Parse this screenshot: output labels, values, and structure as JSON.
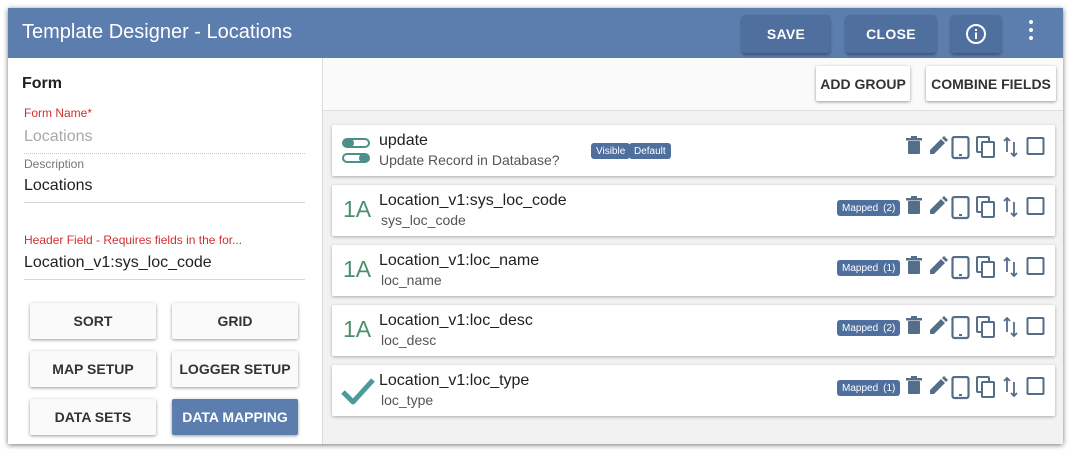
{
  "window": {
    "title": "Template Designer - Locations",
    "save_label": "SAVE",
    "close_label": "CLOSE"
  },
  "form": {
    "heading": "Form",
    "form_name_label": "Form Name",
    "required_mark": "*",
    "form_name_value": "Locations",
    "description_label": "Description",
    "description_value": "Locations",
    "header_field_label": "Header Field - Requires fields in the for...",
    "header_field_value": "Location_v1:sys_loc_code",
    "buttons": {
      "sort": "SORT",
      "grid": "GRID",
      "map_setup": "MAP SETUP",
      "logger_setup": "LOGGER SETUP",
      "data_sets": "DATA SETS",
      "data_mapping": "DATA MAPPING"
    }
  },
  "toolbar": {
    "add_group": "ADD GROUP",
    "combine_fields": "COMBINE FIELDS"
  },
  "fields": [
    {
      "title": "update",
      "subtitle": "Update Record in Database?",
      "badges": [
        "Visible",
        "Default"
      ],
      "icon": "toggle-icon"
    },
    {
      "title": "Location_v1:sys_loc_code",
      "subtitle": "sys_loc_code",
      "type_glyph": "1A",
      "mapped_label": "Mapped",
      "mapped_count": "(2)",
      "icon": "text-type-icon"
    },
    {
      "title": "Location_v1:loc_name",
      "subtitle": "loc_name",
      "type_glyph": "1A",
      "mapped_label": "Mapped",
      "mapped_count": "(1)",
      "icon": "text-type-icon"
    },
    {
      "title": "Location_v1:loc_desc",
      "subtitle": "loc_desc",
      "type_glyph": "1A",
      "mapped_label": "Mapped",
      "mapped_count": "(2)",
      "icon": "text-type-icon"
    },
    {
      "title": "Location_v1:loc_type",
      "subtitle": "loc_type",
      "mapped_label": "Mapped",
      "mapped_count": "(1)",
      "icon": "check-type-icon"
    }
  ],
  "colors": {
    "header": "#5b7eae",
    "accent": "#4f709e",
    "required": "#d32f2f",
    "type_icon": "#4d8f6d",
    "action_icon": "#546e8a"
  }
}
